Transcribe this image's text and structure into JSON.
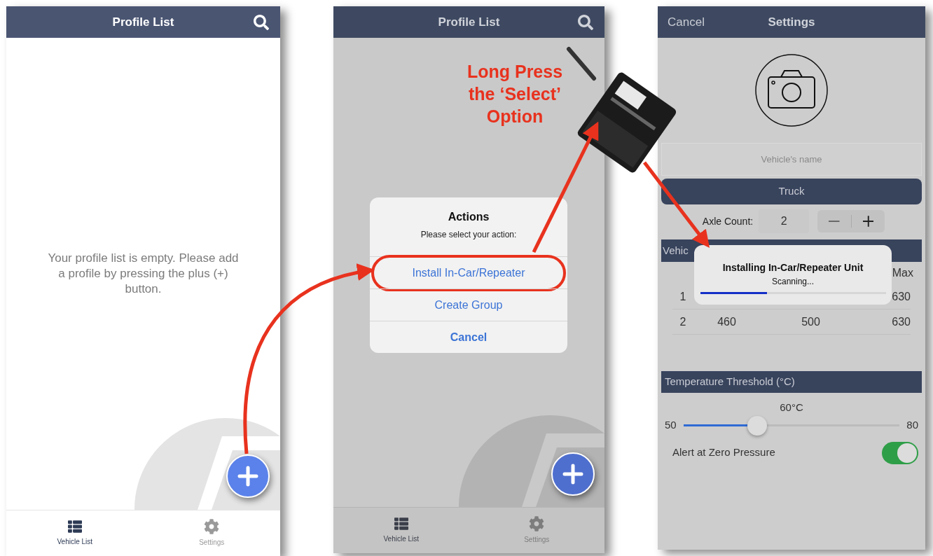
{
  "screens": [
    {
      "kind": "empty_list",
      "header": {
        "title": "Profile List"
      },
      "empty_message": "Your profile list is empty. Please add a profile by pressing the plus (+) button.",
      "tabs": [
        {
          "label": "Vehicle List",
          "selected": true
        },
        {
          "label": "Settings",
          "selected": false
        }
      ]
    },
    {
      "kind": "actions",
      "header": {
        "title": "Profile List"
      },
      "dialog": {
        "title": "Actions",
        "message": "Please select your action:",
        "options": [
          {
            "label": "Install In-Car/Repeater",
            "bold": false,
            "circled": true
          },
          {
            "label": "Create Group",
            "bold": false,
            "circled": false
          },
          {
            "label": "Cancel",
            "bold": true,
            "circled": false
          }
        ]
      },
      "tabs": [
        {
          "label": "Vehicle List",
          "selected": true
        },
        {
          "label": "Settings",
          "selected": false
        }
      ]
    },
    {
      "kind": "settings",
      "header": {
        "left": "Cancel",
        "title": "Settings"
      },
      "name_field": {
        "placeholder": "Vehicle's name"
      },
      "vehicle_type": "Truck",
      "axle": {
        "label": "Axle Count:",
        "value": "2"
      },
      "table": {
        "title": "Vehic",
        "max_header": "Max",
        "rows": [
          {
            "number": "1",
            "max": "630"
          },
          {
            "number": "2",
            "column_2": "460",
            "column_3": "500",
            "max": "630"
          }
        ]
      },
      "progress": {
        "title": "Installing In-Car/Repeater Unit",
        "message": "Scanning...",
        "level": 0.36
      },
      "temperature": {
        "title": "Temperature Threshold (°C)",
        "reading": "60°C",
        "min": "50",
        "max": "80",
        "level": 0.34
      },
      "alert": {
        "label": "Alert at Zero Pressure",
        "on": true
      }
    }
  ],
  "annotation": {
    "lines": [
      "Long Press",
      "the ‘Select’",
      "Option"
    ]
  }
}
